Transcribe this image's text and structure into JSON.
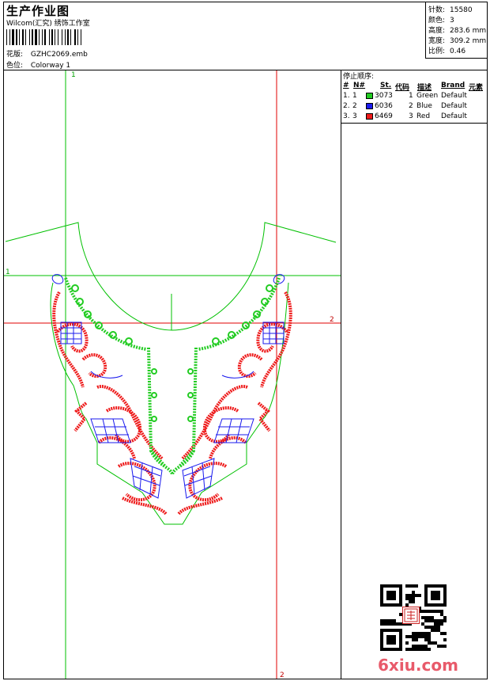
{
  "header": {
    "title": "生产作业图",
    "studio": "Wilcom(汇究) 绣饰工作室",
    "pattern_label": "花版:",
    "pattern_value": "GZHC2069.emb",
    "colorway_label": "色位:",
    "colorway_value": "Colorway 1"
  },
  "stats": [
    {
      "label": "针数:",
      "value": "15580"
    },
    {
      "label": "颜色:",
      "value": "3"
    },
    {
      "label": "高度:",
      "value": "283.6 mm"
    },
    {
      "label": "宽度:",
      "value": "309.2 mm"
    },
    {
      "label": "比例:",
      "value": "0.46"
    }
  ],
  "stop_sequence": {
    "title": "停止顺序:",
    "columns": [
      "#",
      "N#",
      "St.",
      "代码",
      "描述",
      "Brand",
      "元素"
    ],
    "rows": [
      {
        "num": "1.",
        "n": "1",
        "color": "#22cc22",
        "st": "3073",
        "code": "1",
        "desc": "Green",
        "brand": "Default"
      },
      {
        "num": "2.",
        "n": "2",
        "color": "#1a1aee",
        "st": "6036",
        "code": "2",
        "desc": "Blue",
        "brand": "Default"
      },
      {
        "num": "3.",
        "n": "3",
        "color": "#ee1a1a",
        "st": "6469",
        "code": "3",
        "desc": "Red",
        "brand": "Default"
      }
    ]
  },
  "guide_labels": {
    "top": "1",
    "left": "1",
    "right": "2",
    "bottom": "2"
  },
  "watermark": "6xiu.com",
  "colors": {
    "green": "#22cc22",
    "blue": "#1a1aee",
    "red": "#ee1a1a",
    "guide_green": "#00c000",
    "guide_red": "#e00000"
  }
}
